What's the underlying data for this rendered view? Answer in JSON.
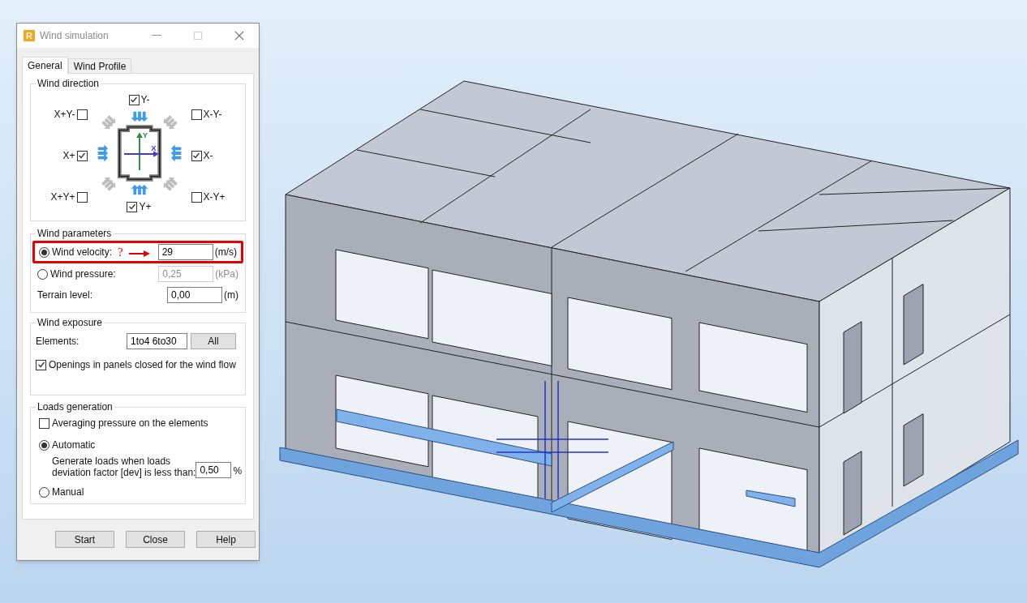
{
  "window": {
    "icon_letter": "R",
    "title": "Wind simulation"
  },
  "tabs": [
    {
      "label": "General",
      "selected": true
    },
    {
      "label": "Wind Profile",
      "selected": false
    }
  ],
  "wind_direction": {
    "title": "Wind direction",
    "axes": {
      "y": "Y",
      "x": "X"
    },
    "left": [
      {
        "label": "X+Y-",
        "checked": false
      },
      {
        "label": "X+",
        "checked": true
      },
      {
        "label": "X+Y+",
        "checked": false
      }
    ],
    "top": {
      "label": "Y-",
      "checked": true
    },
    "bottom": {
      "label": "Y+",
      "checked": true
    },
    "right": [
      {
        "label": "X-Y-",
        "checked": false
      },
      {
        "label": "X-",
        "checked": true
      },
      {
        "label": "X-Y+",
        "checked": false
      }
    ]
  },
  "wind_parameters": {
    "title": "Wind parameters",
    "rows": [
      {
        "kind": "radio",
        "label": "Wind velocity:",
        "selected": true,
        "value": "29",
        "unit": "(m/s)",
        "annotation": "?"
      },
      {
        "kind": "radio",
        "label": "Wind pressure:",
        "selected": false,
        "value": "0,25",
        "unit": "(kPa)"
      },
      {
        "kind": "plain",
        "label": "Terrain level:",
        "value": "0,00",
        "unit": "(m)"
      }
    ]
  },
  "wind_exposure": {
    "title": "Wind exposure",
    "elements_label": "Elements:",
    "elements_value": "1to4 6to30",
    "all_button": "All",
    "openings_closed": {
      "label": "Openings in panels closed for the wind flow",
      "checked": true
    }
  },
  "loads_generation": {
    "title": "Loads generation",
    "averaging": {
      "label": "Averaging pressure on the elements",
      "checked": false
    },
    "automatic": {
      "label": "Automatic",
      "selected": true
    },
    "deviation": {
      "line1": "Generate loads when loads",
      "line2": "deviation factor [dev] is less than:",
      "value": "0,50",
      "unit": "%"
    },
    "manual": {
      "label": "Manual",
      "selected": false
    }
  },
  "buttons": [
    "Start",
    "Close",
    "Help"
  ]
}
